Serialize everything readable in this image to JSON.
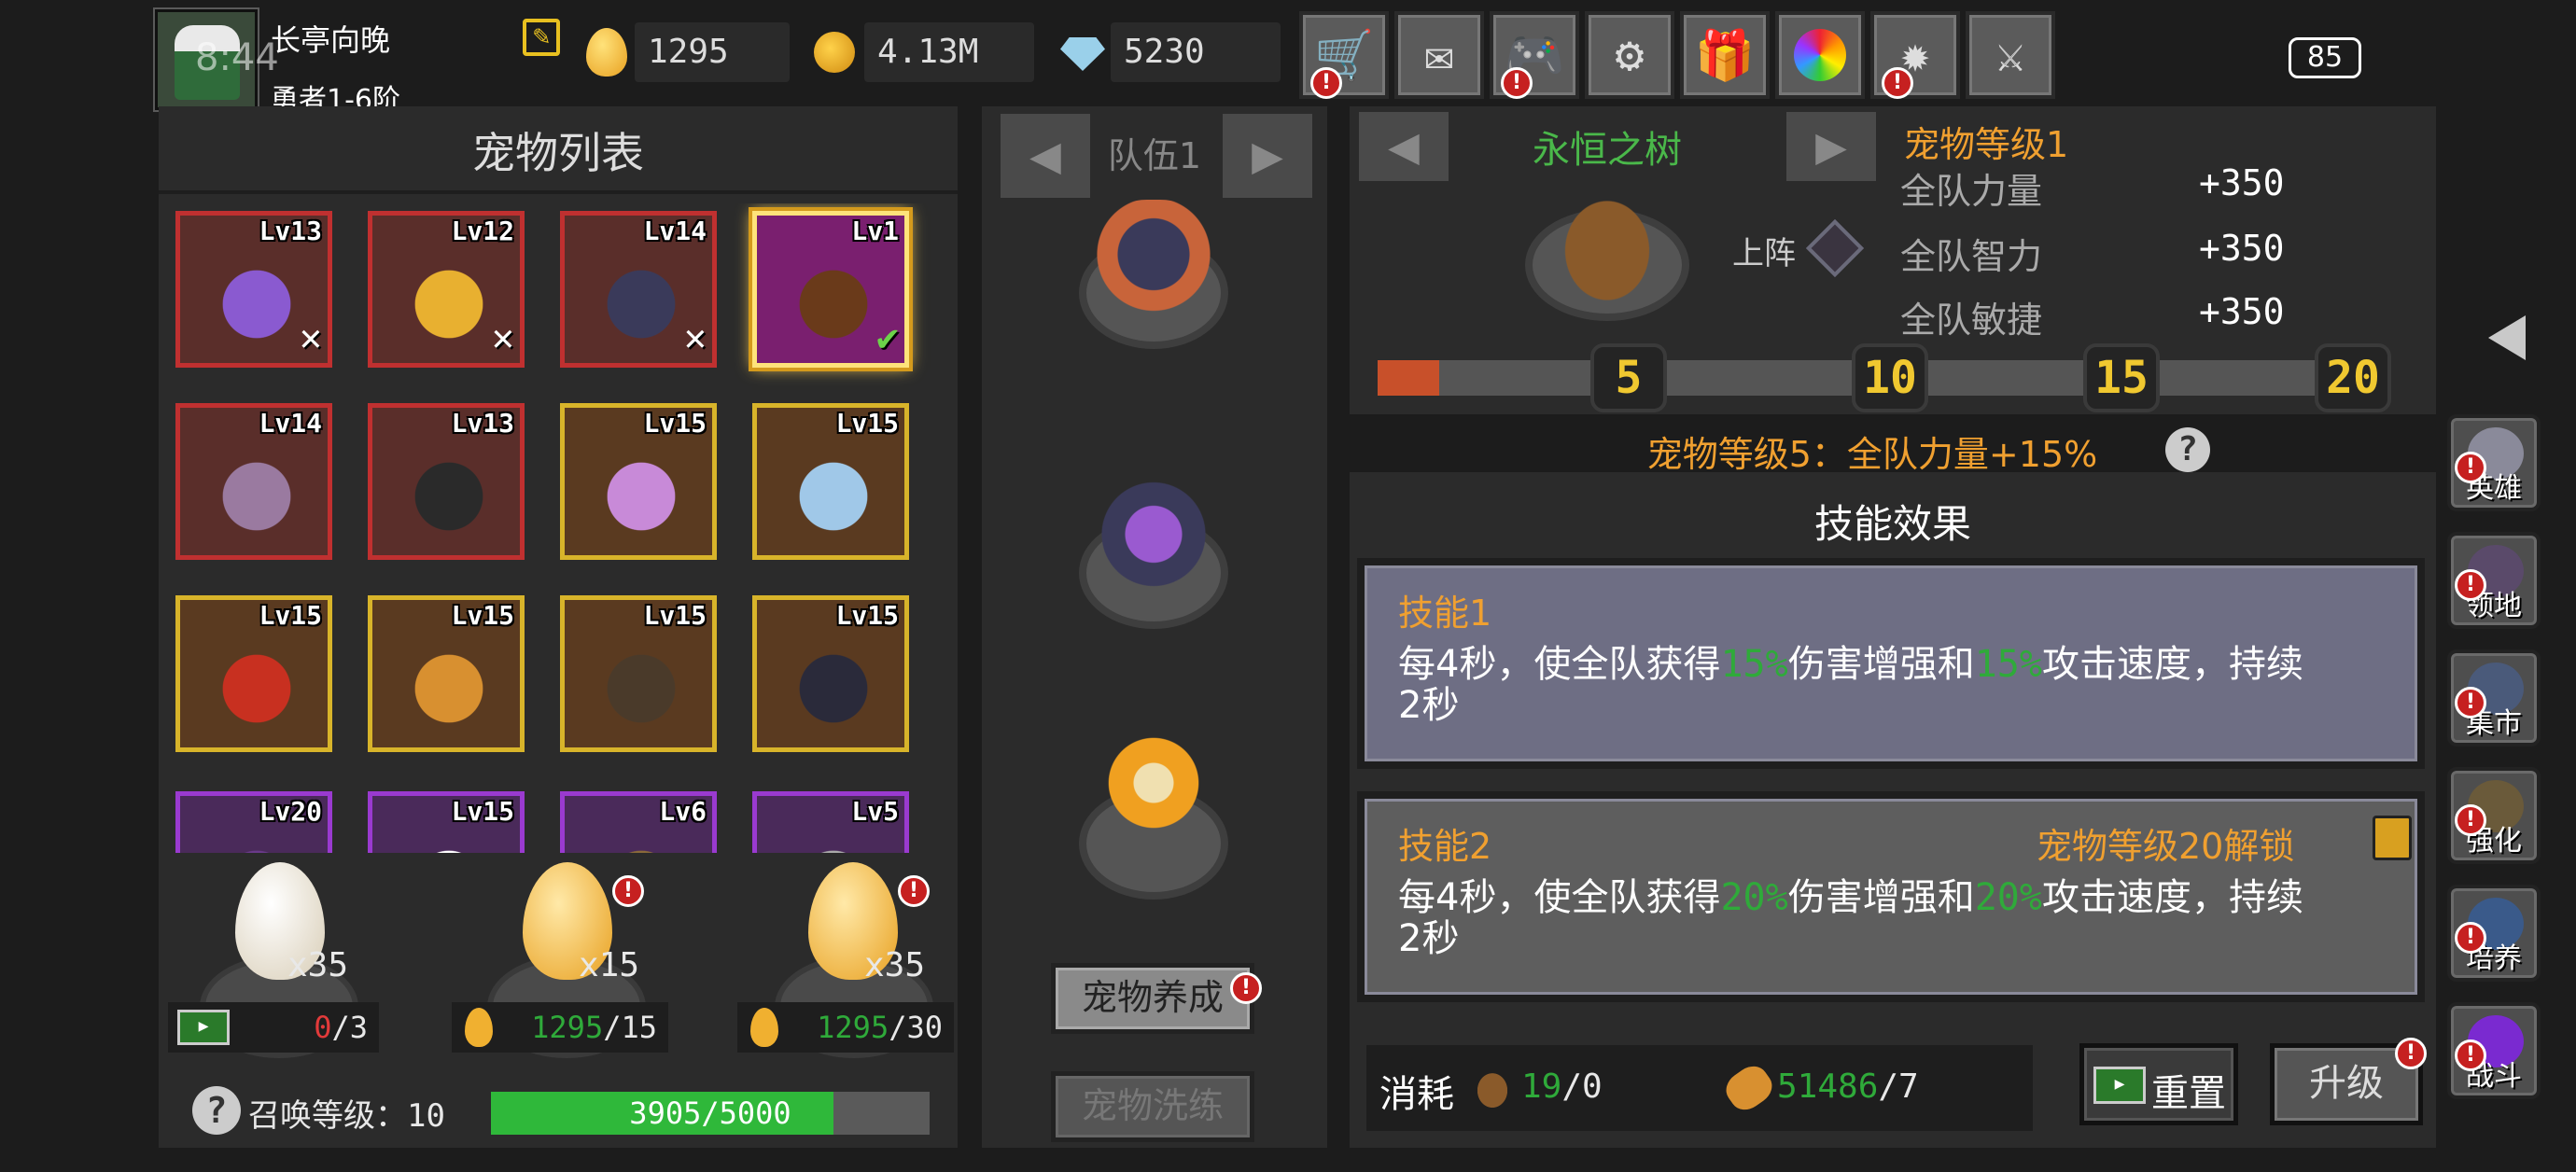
{
  "player": {
    "name": "长亭向晚",
    "rank": "勇者1-6阶",
    "overlay_clock": "8:44"
  },
  "resources": [
    {
      "icon": "egg-icon",
      "value": "1295"
    },
    {
      "icon": "gold-coin-icon",
      "value": "4.13M"
    },
    {
      "icon": "diamond-icon",
      "value": "5230"
    }
  ],
  "top_buttons": [
    {
      "icon": "shop-cart-icon",
      "alert": true
    },
    {
      "icon": "mail-icon",
      "alert": false
    },
    {
      "icon": "gamepad-icon",
      "alert": true
    },
    {
      "icon": "gear-icon",
      "alert": false
    },
    {
      "icon": "gift-icon",
      "alert": false
    },
    {
      "icon": "color-wheel-icon",
      "alert": false
    },
    {
      "icon": "firework-icon",
      "alert": true
    },
    {
      "icon": "crossed-swords-icon",
      "alert": false
    }
  ],
  "battery": "85",
  "pet_list": {
    "title": "宠物列表",
    "pets": [
      {
        "level": "Lv13",
        "mark": "✕",
        "frame": "red"
      },
      {
        "level": "Lv12",
        "mark": "✕",
        "frame": "red"
      },
      {
        "level": "Lv14",
        "mark": "✕",
        "frame": "red"
      },
      {
        "level": "Lv1",
        "mark": "✔",
        "frame": "selected"
      },
      {
        "level": "Lv14",
        "mark": "",
        "frame": "red"
      },
      {
        "level": "Lv13",
        "mark": "",
        "frame": "red"
      },
      {
        "level": "Lv15",
        "mark": "",
        "frame": "gold"
      },
      {
        "level": "Lv15",
        "mark": "",
        "frame": "gold"
      },
      {
        "level": "Lv15",
        "mark": "",
        "frame": "gold"
      },
      {
        "level": "Lv15",
        "mark": "",
        "frame": "gold"
      },
      {
        "level": "Lv15",
        "mark": "",
        "frame": "gold"
      },
      {
        "level": "Lv15",
        "mark": "",
        "frame": "gold"
      },
      {
        "level": "Lv20",
        "mark": "",
        "frame": "purple"
      },
      {
        "level": "Lv15",
        "mark": "",
        "frame": "purple"
      },
      {
        "level": "Lv6",
        "mark": "",
        "frame": "purple"
      },
      {
        "level": "Lv5",
        "mark": "",
        "frame": "purple"
      }
    ]
  },
  "eggs": [
    {
      "count": "x35",
      "cost_have": "0",
      "cost_need": "/3",
      "cost_icon": "video-ad-icon",
      "alert": false
    },
    {
      "count": "x15",
      "cost_have": "1295",
      "cost_need": "/15",
      "cost_icon": "egg-icon",
      "alert": true
    },
    {
      "count": "x35",
      "cost_have": "1295",
      "cost_need": "/30",
      "cost_icon": "egg-icon",
      "alert": true
    }
  ],
  "summon": {
    "label": "召唤等级：",
    "level": "10",
    "progress_text": "3905/5000",
    "progress": 0.781
  },
  "team": {
    "label": "队伍1",
    "nurture_btn": "宠物养成",
    "refine_btn": "宠物洗练"
  },
  "pet_detail": {
    "name": "永恒之树",
    "deploy_label": "上阵",
    "level_title": "宠物等级1",
    "stats": [
      {
        "label": "全队力量",
        "value": "+350"
      },
      {
        "label": "全队智力",
        "value": "+350"
      },
      {
        "label": "全队敏捷",
        "value": "+350"
      }
    ],
    "milestones": [
      "5",
      "10",
      "15",
      "20"
    ],
    "bonus_text": "宠物等级5：全队力量+15%"
  },
  "skills": {
    "title": "技能效果",
    "list": [
      {
        "name": "技能1",
        "locked": false,
        "lock_text": "",
        "text_a": "每4秒，使全队获得",
        "pct1": "15%",
        "text_b": "伤害增强和",
        "pct2": "15%",
        "text_c": "攻击速度，持续",
        "text_d": "2秒"
      },
      {
        "name": "技能2",
        "locked": true,
        "lock_text": "宠物等级20解锁",
        "text_a": "每4秒，使全队获得",
        "pct1": "20%",
        "text_b": "伤害增强和",
        "pct2": "20%",
        "text_c": "攻击速度，持续",
        "text_d": "2秒"
      }
    ]
  },
  "cost": {
    "label": "消耗",
    "item1_have": "19",
    "item1_need": "/0",
    "item2_have": "51486",
    "item2_need": "/7",
    "reset_btn": "重置",
    "upgrade_btn": "升级"
  },
  "side_nav": [
    {
      "label": "英雄",
      "icon": "helmet-icon",
      "alert": true
    },
    {
      "label": "领地",
      "icon": "castle-icon",
      "alert": true
    },
    {
      "label": "集市",
      "icon": "market-icon",
      "alert": true
    },
    {
      "label": "强化",
      "icon": "gem-icon",
      "alert": true
    },
    {
      "label": "培养",
      "icon": "chalice-icon",
      "alert": true
    },
    {
      "label": "战斗",
      "icon": "portal-icon",
      "alert": true
    }
  ],
  "colors": {
    "accent_orange": "#f0a030",
    "green": "#2faa3a",
    "alert_red": "#c62020",
    "gold": "#f0c830"
  }
}
